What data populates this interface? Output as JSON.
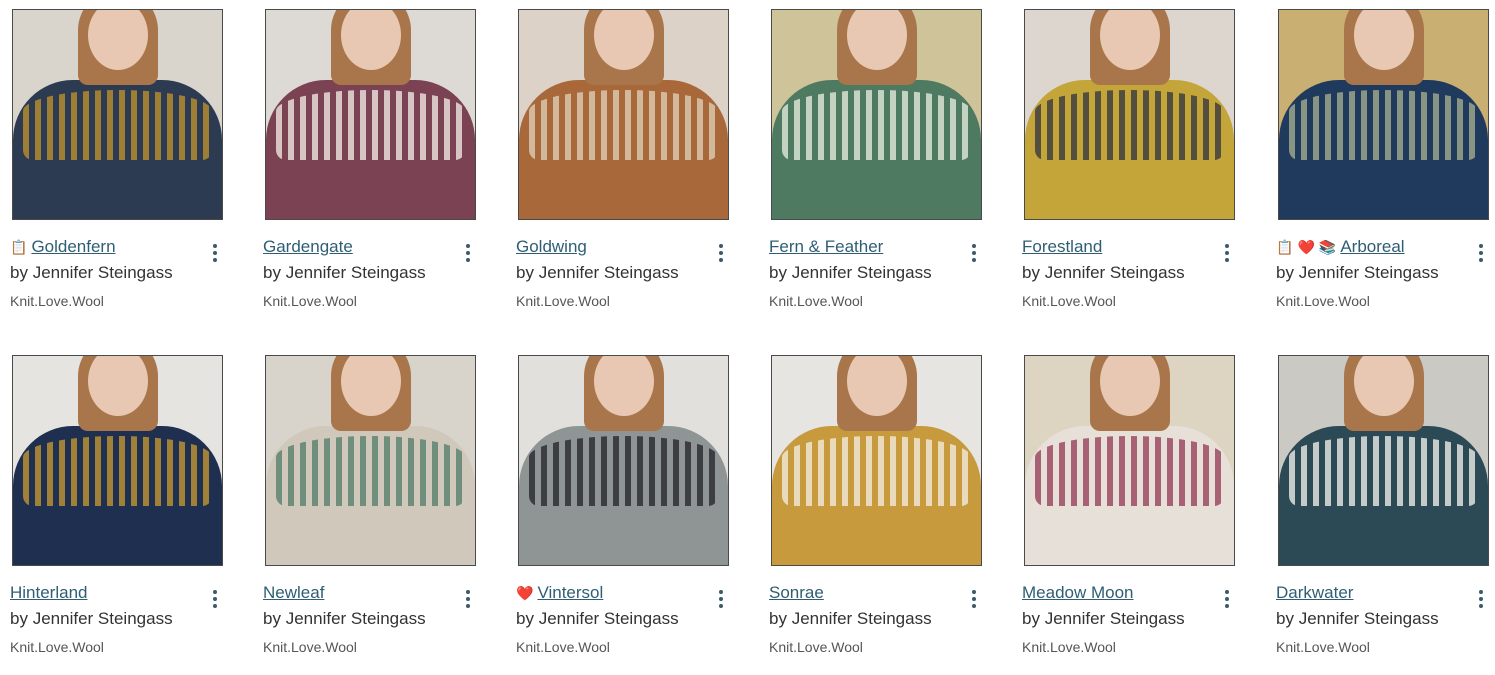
{
  "patterns": [
    {
      "title": "Goldenfern",
      "designer": "Jennifer Steingass",
      "source": "Knit.Love.Wool",
      "by": "by",
      "icons": [
        "list-icon"
      ],
      "colors": {
        "bg": "#d9d4cc",
        "sweater": "#2d3b52",
        "yoke": "#b28a2e"
      }
    },
    {
      "title": "Gardengate",
      "designer": "Jennifer Steingass",
      "source": "Knit.Love.Wool",
      "by": "by",
      "icons": [],
      "colors": {
        "bg": "#ddd9d4",
        "sweater": "#7a4252",
        "yoke": "#e6dcd6"
      }
    },
    {
      "title": "Goldwing",
      "designer": "Jennifer Steingass",
      "source": "Knit.Love.Wool",
      "by": "by",
      "icons": [],
      "colors": {
        "bg": "#dcd2c8",
        "sweater": "#a8683a",
        "yoke": "#d9c7ae"
      }
    },
    {
      "title": "Fern & Feather",
      "designer": "Jennifer Steingass",
      "source": "Knit.Love.Wool",
      "by": "by",
      "icons": [],
      "colors": {
        "bg": "#cfc39a",
        "sweater": "#4f7a62",
        "yoke": "#d9e2d2"
      }
    },
    {
      "title": "Forestland",
      "designer": "Jennifer Steingass",
      "source": "Knit.Love.Wool",
      "by": "by",
      "icons": [],
      "colors": {
        "bg": "#dcd6cf",
        "sweater": "#c4a53a",
        "yoke": "#3f3f3f"
      }
    },
    {
      "title": "Arboreal",
      "designer": "Jennifer Steingass",
      "source": "Knit.Love.Wool",
      "by": "by",
      "icons": [
        "list-icon",
        "heart-icon",
        "library-icon"
      ],
      "colors": {
        "bg": "#c9b072",
        "sweater": "#1f3a5c",
        "yoke": "#9aa58a"
      }
    },
    {
      "title": "Hinterland",
      "designer": "Jennifer Steingass",
      "source": "Knit.Love.Wool",
      "by": "by",
      "icons": [],
      "colors": {
        "bg": "#e6e4e0",
        "sweater": "#1f2f50",
        "yoke": "#b88e34"
      }
    },
    {
      "title": "Newleaf",
      "designer": "Jennifer Steingass",
      "source": "Knit.Love.Wool",
      "by": "by",
      "icons": [],
      "colors": {
        "bg": "#d8d3cb",
        "sweater": "#cfc8bb",
        "yoke": "#5e8470"
      }
    },
    {
      "title": "Vintersol",
      "designer": "Jennifer Steingass",
      "source": "Knit.Love.Wool",
      "by": "by",
      "icons": [
        "heart-icon"
      ],
      "colors": {
        "bg": "#e2e0dc",
        "sweater": "#8f9594",
        "yoke": "#2e2e34"
      }
    },
    {
      "title": "Sonrae",
      "designer": "Jennifer Steingass",
      "source": "Knit.Love.Wool",
      "by": "by",
      "icons": [],
      "colors": {
        "bg": "#e7e5e2",
        "sweater": "#c79a3e",
        "yoke": "#f0e6d2"
      }
    },
    {
      "title": "Meadow Moon",
      "designer": "Jennifer Steingass",
      "source": "Knit.Love.Wool",
      "by": "by",
      "icons": [],
      "colors": {
        "bg": "#ddd4c2",
        "sweater": "#e6e0d8",
        "yoke": "#9d4a63"
      }
    },
    {
      "title": "Darkwater",
      "designer": "Jennifer Steingass",
      "source": "Knit.Love.Wool",
      "by": "by",
      "icons": [],
      "colors": {
        "bg": "#cbc9c4",
        "sweater": "#2c4a56",
        "yoke": "#dfe2dc"
      }
    }
  ],
  "theme": {
    "link": "#2f5e74",
    "text": "#333333",
    "muted": "#555555",
    "menu": "#3c5a6a"
  }
}
